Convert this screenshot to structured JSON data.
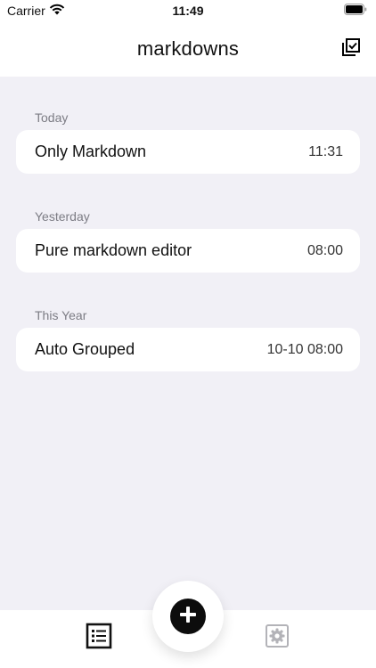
{
  "status_bar": {
    "carrier": "Carrier",
    "time": "11:49"
  },
  "nav": {
    "title": "markdowns",
    "select_icon": "checklist-select-icon"
  },
  "sections": [
    {
      "header": "Today",
      "items": [
        {
          "title": "Only Markdown",
          "time": "11:31"
        }
      ]
    },
    {
      "header": "Yesterday",
      "items": [
        {
          "title": "Pure markdown editor",
          "time": "08:00"
        }
      ]
    },
    {
      "header": "This Year",
      "items": [
        {
          "title": "Auto Grouped",
          "time": "10-10 08:00"
        }
      ]
    }
  ],
  "tab_bar": {
    "tabs": [
      {
        "icon": "list-icon",
        "active": true
      },
      {
        "icon": "gear-icon",
        "active": false
      }
    ],
    "add_icon": "plus-icon"
  },
  "colors": {
    "background": "#f1f0f6",
    "card": "#ffffff",
    "section_header": "#7c7c84",
    "accent": "#0c0c0c",
    "inactive_icon": "#b3b3b8"
  }
}
